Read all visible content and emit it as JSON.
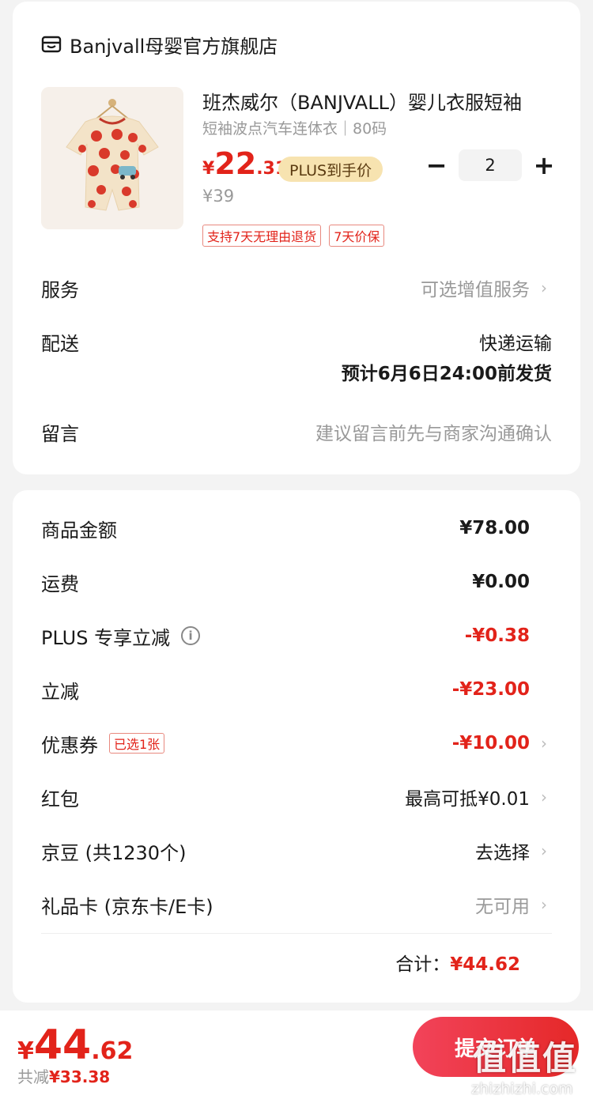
{
  "store": {
    "icon": "store-icon",
    "name": "Banjvall母婴官方旗舰店"
  },
  "product": {
    "title": "班杰威尔（BANJVALL）婴儿衣服短袖",
    "spec": "短袖波点汽车连体衣｜80码",
    "price_symbol": "¥",
    "price_int": "22",
    "price_dec": ".31",
    "plus_badge": "PLUS到手价",
    "original_price": "¥39",
    "quantity": "2",
    "minus_label": "−",
    "plus_label": "+",
    "tags": [
      "支持7天无理由退货",
      "7天价保"
    ]
  },
  "service": {
    "label": "服务",
    "value": "可选增值服务"
  },
  "delivery": {
    "label": "配送",
    "line1": "快递运输",
    "line2": "预计6月6日24:00前发货"
  },
  "message": {
    "label": "留言",
    "placeholder": "建议留言前先与商家沟通确认"
  },
  "summary": {
    "goods": {
      "label": "商品金额",
      "value": "¥78.00"
    },
    "shipping": {
      "label": "运费",
      "value": "¥0.00"
    },
    "plus_discount": {
      "label": "PLUS 专享立减",
      "value": "-¥0.38"
    },
    "instant_discount": {
      "label": "立减",
      "value": "-¥23.00"
    },
    "coupon": {
      "label": "优惠券",
      "badge": "已选1张",
      "value": "-¥10.00"
    },
    "red_packet": {
      "label": "红包",
      "value": "最高可抵¥0.01"
    },
    "jingdou": {
      "label": "京豆 (共1230个)",
      "value": "去选择"
    },
    "gift_card": {
      "label": "礼品卡 (京东卡/E卡)",
      "value": "无可用"
    },
    "total_label": "合计：",
    "total_value": "¥44.62"
  },
  "bottom": {
    "price_symbol": "¥",
    "price_int": "44",
    "price_dec": ".62",
    "save_prefix": "共减",
    "save_value": "¥33.38",
    "submit_label": "提交订单"
  },
  "watermark": {
    "text": "值值值",
    "url": "zhizhizhi.com"
  },
  "colors": {
    "accent": "#e2231a",
    "plus_badge_bg": "#f7e3b0"
  }
}
